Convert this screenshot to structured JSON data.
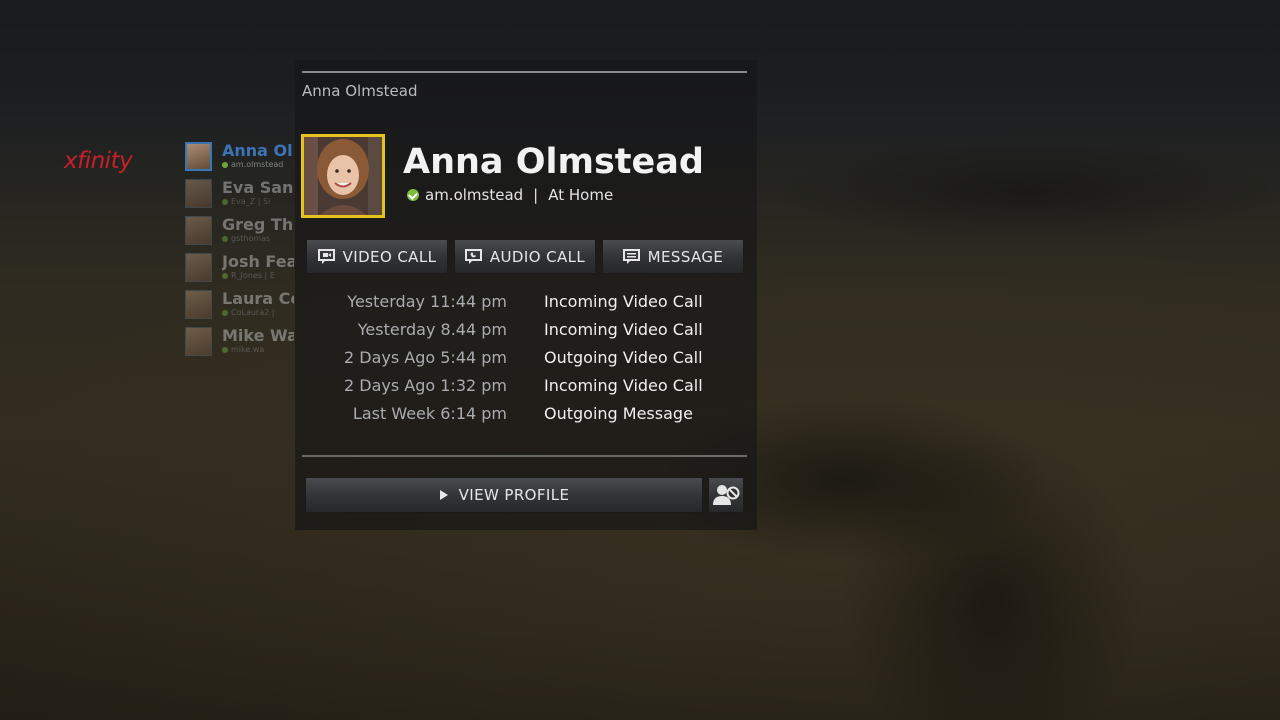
{
  "brand": {
    "logo_text": "xfinity",
    "logo_color": "#c8202a"
  },
  "breadcrumb": "Anna Olmstead",
  "contacts": [
    {
      "name": "Anna Olmstead",
      "handle": "am.olmstead",
      "active": true
    },
    {
      "name": "Eva Sanchez",
      "handle": "Eva_Z | Si",
      "active": false
    },
    {
      "name": "Greg Thomas",
      "handle": "gsthomas",
      "active": false
    },
    {
      "name": "Josh Fea",
      "handle": "R_Jones | E",
      "active": false
    },
    {
      "name": "Laura Co",
      "handle": "CoLaura2 |",
      "active": false
    },
    {
      "name": "Mike Wa",
      "handle": "mike.wa",
      "active": false
    }
  ],
  "profile": {
    "name": "Anna Olmstead",
    "handle": "am.olmstead",
    "status": "At Home",
    "status_color": "#7cbc3d",
    "photo_border_color": "#e6c21e"
  },
  "actions": {
    "video_call": "VIDEO CALL",
    "audio_call": "AUDIO CALL",
    "message": "MESSAGE"
  },
  "history": [
    {
      "time": "Yesterday 11:44 pm",
      "type": "Incoming Video Call"
    },
    {
      "time": "Yesterday 8.44 pm",
      "type": "Incoming Video Call"
    },
    {
      "time": "2 Days Ago 5:44 pm",
      "type": "Outgoing Video Call"
    },
    {
      "time": "2 Days Ago 1:32 pm",
      "type": "Incoming Video Call"
    },
    {
      "time": "Last Week 6:14 pm",
      "type": "Outgoing Message"
    }
  ],
  "footer": {
    "view_profile": "VIEW PROFILE"
  },
  "icons": {
    "video_call": "video-call-icon",
    "audio_call": "audio-call-icon",
    "message": "message-icon",
    "play": "play-arrow-icon",
    "block": "block-contact-icon",
    "status": "check-circle-icon"
  }
}
